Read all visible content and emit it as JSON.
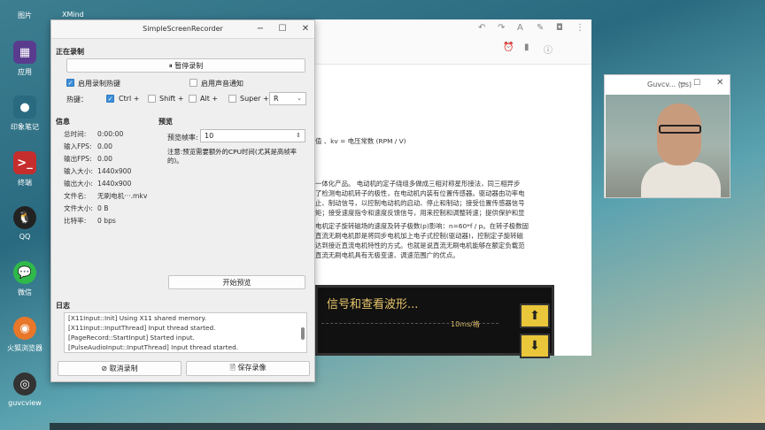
{
  "desktop": {
    "dock": [
      {
        "label": "图片",
        "icon": "photos-icon",
        "color": "#2f9ee0"
      },
      {
        "label": "应用",
        "icon": "apps-icon",
        "color": "#5a3c8f"
      },
      {
        "label": "印象笔记",
        "icon": "evernote-icon",
        "color": "#2a6a80"
      },
      {
        "label": "终端",
        "icon": "terminal-icon",
        "color": "#c62d2d"
      },
      {
        "label": "QQ",
        "icon": "qq-icon",
        "color": "#222222"
      },
      {
        "label": "微信",
        "icon": "wechat-icon",
        "color": "#2fb94a"
      },
      {
        "label": "火狐浏览器",
        "icon": "firefox-icon",
        "color": "#e8772a"
      },
      {
        "label": "guvcview",
        "icon": "webcam-icon",
        "color": "#333333"
      }
    ],
    "xmind_label": "XMind"
  },
  "document": {
    "lines": [
      "值 、kv = 电压常数 (RPM / V)",
      "一体化产品。 电动机的定子绕组多做成三相对称星形接法，同三相异步",
      "了检测电动机转子的极性，在电动机内装有位置传感器。驱动器由功率电",
      "止、制动信号，以控制电动机的启动、停止和制动；接受位置传感器信号",
      "矩；接受速度指令和速度反馈信号，用来控制和调整转速；提供保护和显",
      "电机定子旋转磁场的速度及转子极数(p)影响：n=60*f / p。在转子极数固",
      "直流无刷电机即是将同步电机加上电子式控制(驱动器)，控制定子旋转磁",
      "达到接近直流电机特性的方式。也就是说直流无刷电机能够在额定负载范",
      "直流无刷电机具有无极变速、调速范围广的优点。"
    ],
    "figure_title": "信号和查看波形...",
    "figure_sub": "10ms/格"
  },
  "camera": {
    "title": "Guvcv... (ps)"
  },
  "ssr": {
    "title": "SimpleScreenRecorder",
    "recording_section": "正在录制",
    "pause_label": "⏸ 暂停录制",
    "enable_hotkey_label": "启用录制热键",
    "enable_sound_label": "启用声音通知",
    "hotkey_label": "热键：",
    "ctrl_label": "Ctrl +",
    "shift_label": "Shift +",
    "alt_label": "Alt +",
    "super_label": "Super +",
    "key_value": "R",
    "info_section": "信息",
    "info": [
      {
        "k": "总时间:",
        "v": "0:00:00"
      },
      {
        "k": "输入FPS:",
        "v": "0.00"
      },
      {
        "k": "输出FPS:",
        "v": "0.00"
      },
      {
        "k": "输入大小:",
        "v": "1440x900"
      },
      {
        "k": "输出大小:",
        "v": "1440x900"
      },
      {
        "k": "文件名:",
        "v": "无刷电机···.mkv"
      },
      {
        "k": "文件大小:",
        "v": "0 B"
      },
      {
        "k": "比特率:",
        "v": "0 bps"
      }
    ],
    "preview_section": "预览",
    "preview_rate_label": "预览帧率:",
    "preview_rate_value": "10",
    "preview_note": "注意:预览需要额外的CPU时间(尤其是高帧率的)。",
    "start_preview_label": "开始预览",
    "log_section": "日志",
    "log": [
      "[X11Input::Init] Using X11 shared memory.",
      "[X11Input::InputThread] Input thread started.",
      "[PageRecord::StartInput] Started input.",
      "[PulseAudioInput::InputThread] Input thread started."
    ],
    "cancel_label": "⊘ 取消录制",
    "save_label": "🗎 保存录像"
  }
}
